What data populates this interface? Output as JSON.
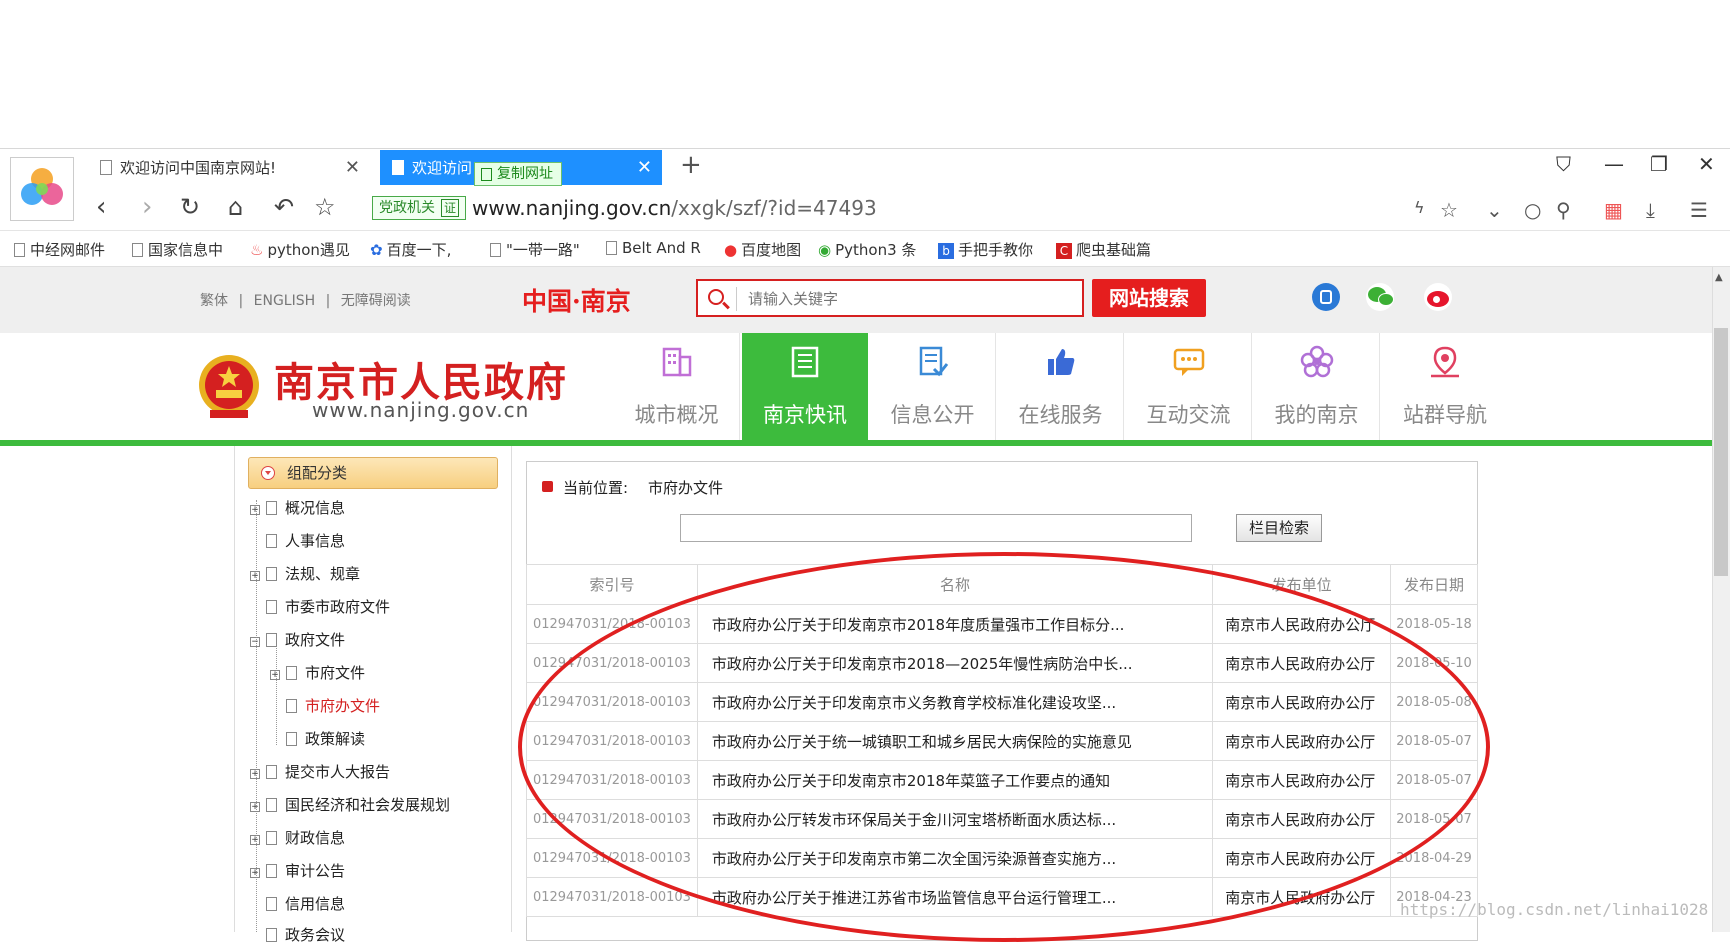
{
  "browser": {
    "tabs": [
      {
        "label": "欢迎访问中国南京网站!"
      },
      {
        "label": "欢迎访问"
      }
    ],
    "copy_url_label": "复制网址",
    "address_badge": "党政机关",
    "address_badge_cert": "证",
    "url_domain": "www.nanjing.gov.cn",
    "url_path": "/xxgk/szf/?id=47493",
    "bookmarks": [
      "中经网邮件",
      "国家信息中",
      "python遇见",
      "百度一下,",
      "\"一带一路\"",
      "Belt And R",
      "百度地图",
      "Python3 条",
      "手把手教你",
      "爬虫基础篇"
    ]
  },
  "site": {
    "lang_links": [
      "繁体",
      "|",
      "ENGLISH",
      "|",
      "无障碍阅读"
    ],
    "china_nanjing": "中国·南京",
    "search_placeholder": "请输入关键字",
    "search_button": "网站搜索",
    "gov_title": "南京市人民政府",
    "gov_url": "www.nanjing.gov.cn",
    "nav": [
      "城市概况",
      "南京快讯",
      "信息公开",
      "在线服务",
      "互动交流",
      "我的南京",
      "站群导航"
    ],
    "colors": {
      "red": "#e51e1e",
      "green": "#3dbb3d",
      "tab_blue": "#1e90ff"
    }
  },
  "sidebar": {
    "category_header": "组配分类",
    "items": [
      "概况信息",
      "人事信息",
      "法规、规章",
      "市委市政府文件",
      "政府文件",
      "市府文件",
      "市府办文件",
      "政策解读",
      "提交市人大报告",
      "国民经济和社会发展规划",
      "财政信息",
      "审计公告",
      "信用信息",
      "政务会议"
    ]
  },
  "content": {
    "location_label": "当前位置:",
    "location_value": "市府办文件",
    "column_search_button": "栏目检索",
    "table": {
      "headers": [
        "索引号",
        "名称",
        "发布单位",
        "发布日期"
      ],
      "rows": [
        [
          "012947031/2018-00103",
          "市政府办公厅关于印发南京市2018年度质量强市工作目标分...",
          "南京市人民政府办公厅",
          "2018-05-18"
        ],
        [
          "012947031/2018-00103",
          "市政府办公厅关于印发南京市2018—2025年慢性病防治中长...",
          "南京市人民政府办公厅",
          "2018-05-10"
        ],
        [
          "012947031/2018-00103",
          "市政府办公厅关于印发南京市义务教育学校标准化建设攻坚...",
          "南京市人民政府办公厅",
          "2018-05-08"
        ],
        [
          "012947031/2018-00103",
          "市政府办公厅关于统一城镇职工和城乡居民大病保险的实施意见",
          "南京市人民政府办公厅",
          "2018-05-07"
        ],
        [
          "012947031/2018-00103",
          "市政府办公厅关于印发南京市2018年菜篮子工作要点的通知",
          "南京市人民政府办公厅",
          "2018-05-07"
        ],
        [
          "012947031/2018-00103",
          "市政府办公厅转发市环保局关于金川河宝塔桥断面水质达标...",
          "南京市人民政府办公厅",
          "2018-05-07"
        ],
        [
          "012947031/2018-00103",
          "市政府办公厅关于印发南京市第二次全国污染源普查实施方...",
          "南京市人民政府办公厅",
          "2018-04-29"
        ],
        [
          "012947031/2018-00103",
          "市政府办公厅关于推进江苏省市场监管信息平台运行管理工...",
          "南京市人民政府办公厅",
          "2018-04-23"
        ]
      ]
    }
  },
  "watermark": "https://blog.csdn.net/linhai1028"
}
